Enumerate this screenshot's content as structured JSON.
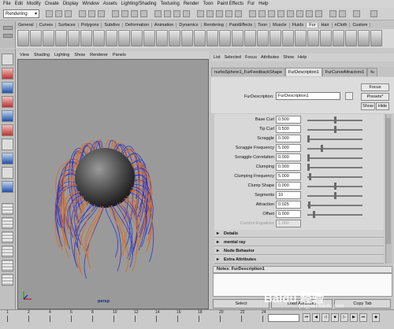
{
  "menubar": [
    "File",
    "Edit",
    "Modify",
    "Create",
    "Display",
    "Window",
    "Assets",
    "Lighting/Shading",
    "Texturing",
    "Render",
    "Toon",
    "Paint Effects",
    "Fur",
    "Help"
  ],
  "statusline": {
    "mode": "Rendering"
  },
  "shelf_tabs": [
    "General",
    "Curves",
    "Surfaces",
    "Polygons",
    "Subdivs",
    "Deformation",
    "Animation",
    "Dynamics",
    "Rendering",
    "PaintEffects",
    "Toon",
    "Muscle",
    "Fluids",
    "Fur",
    "Hair",
    "nCloth",
    "Custom"
  ],
  "shelf_active": "Fur",
  "viewport": {
    "menu": [
      "View",
      "Shading",
      "Lighting",
      "Show",
      "Renderer",
      "Panels"
    ],
    "camera": "persp"
  },
  "attribute_editor": {
    "menu": [
      "List",
      "Selected",
      "Focus",
      "Attributes",
      "Show",
      "Help"
    ],
    "tabs": [
      "nurbsSphere1_FurFeedbackShape",
      "FurDescription1",
      "FurCurveAttractors1",
      "fu"
    ],
    "active_tab": "FurDescription1",
    "furdesc_label": "FurDescription:",
    "furdesc_value": "FurDescription1",
    "focus_label": "Focus",
    "presets_label": "Presets*",
    "show_label": "Show",
    "hide_label": "Hide",
    "rows": [
      {
        "label": "Base Curl",
        "value": "0.500",
        "slider": 0.5,
        "dim": false
      },
      {
        "label": "Tip Curl",
        "value": "0.500",
        "slider": 0.5,
        "dim": false
      },
      {
        "label": "Scraggle",
        "value": "0.000",
        "slider": 0.0,
        "dim": false
      },
      {
        "label": "Scraggle Frequency",
        "value": "5.000",
        "slider": 0.25,
        "dim": false
      },
      {
        "label": "Scraggle Correlation",
        "value": "0.000",
        "slider": 0.0,
        "dim": false
      },
      {
        "label": "Clumping",
        "value": "0.000",
        "slider": 0.0,
        "dim": false
      },
      {
        "label": "Clumping Frequency",
        "value": "5.000",
        "slider": 0.03,
        "dim": false
      },
      {
        "label": "Clump Shape",
        "value": "0.000",
        "slider": 0.5,
        "dim": false
      },
      {
        "label": "Segments",
        "value": "10",
        "slider": 0.5,
        "dim": false
      },
      {
        "label": "Attraction",
        "value": "0.025",
        "slider": 0.02,
        "dim": false
      },
      {
        "label": "Offset",
        "value": "0.000",
        "slider": 0.1,
        "dim": false
      },
      {
        "label": "Custom Equalizer",
        "value": "1.000",
        "slider": null,
        "dim": true
      }
    ],
    "sections": [
      "Details",
      "mental ray",
      "Node Behavior",
      "Extra Attributes"
    ],
    "notes_label": "Notes:  FurDescription1",
    "buttons": [
      "Select",
      "Load Attributes",
      "Copy Tab"
    ]
  },
  "timeline": {
    "ticks": [
      "1",
      "2",
      "4",
      "6",
      "8",
      "10",
      "12",
      "14",
      "16",
      "18",
      "20",
      "22",
      "24"
    ]
  },
  "watermark": {
    "text": "Baidu 经验",
    "url": "jingyan.baidu.com"
  },
  "colors": {
    "fur_blue": "#2a3ccf",
    "fur_orange": "#e06a18",
    "viewport_bg": "#9a9a9a"
  }
}
